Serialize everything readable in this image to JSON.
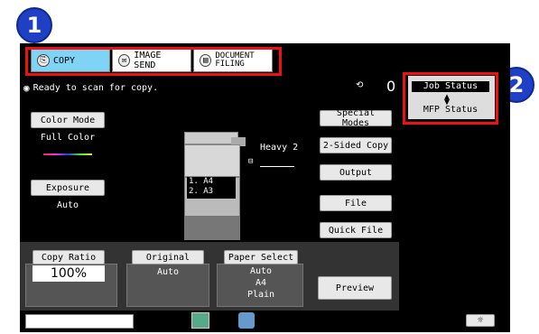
{
  "markers": {
    "m1": "1",
    "m2": "2"
  },
  "tabs": [
    {
      "label": "COPY",
      "icon": "copy-icon"
    },
    {
      "label": "IMAGE SEND",
      "icon": "image-send-icon"
    },
    {
      "label": "DOCUMENT FILING",
      "icon": "document-filing-icon"
    }
  ],
  "status": {
    "message": "Ready to scan for copy.",
    "count": "0"
  },
  "job": {
    "job_status": "Job Status",
    "mfp_status": "MFP Status",
    "toggle_icon": "up-down-arrows-icon"
  },
  "left": {
    "color_mode_label": "Color Mode",
    "color_mode_value": "Full Color",
    "exposure_label": "Exposure",
    "exposure_value": "Auto"
  },
  "machine": {
    "output_label": "Heavy 2",
    "tray1": "1. A4",
    "tray2": "2. A3"
  },
  "right_buttons": [
    "Special Modes",
    "2-Sided Copy",
    "Output",
    "File",
    "Quick File"
  ],
  "bottom": {
    "copy_ratio_label": "Copy Ratio",
    "copy_ratio_value": "100%",
    "original_label": "Original",
    "original_value": "Auto",
    "paper_select_label": "Paper Select",
    "paper_line1": "Auto",
    "paper_line2": "A4",
    "paper_line3": "Plain",
    "preview_label": "Preview"
  },
  "colors": {
    "accent": "#7fd3f5",
    "highlight": "#e11111",
    "marker": "#1f3fc4"
  }
}
